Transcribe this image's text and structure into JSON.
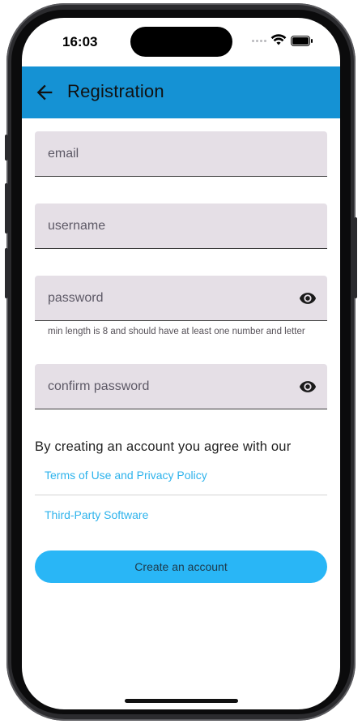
{
  "status_bar": {
    "time": "16:03"
  },
  "app_bar": {
    "title": "Registration"
  },
  "form": {
    "email_placeholder": "email",
    "username_placeholder": "username",
    "password_placeholder": "password",
    "password_helper": "min length is 8 and should have at least one number and letter",
    "confirm_placeholder": "confirm password"
  },
  "agreement": {
    "text": "By creating an account you agree with our",
    "terms_link": "Terms of Use and Privacy Policy",
    "third_party_link": "Third-Party Software"
  },
  "actions": {
    "create_label": "Create an account"
  },
  "colors": {
    "app_bar": "#1592d4",
    "field_bg": "#e5dfe6",
    "link": "#2eb3ec",
    "button": "#29b6f6"
  },
  "icons": [
    "back-arrow-icon",
    "eye-icon",
    "wifi-icon",
    "battery-icon",
    "signal-icon"
  ]
}
